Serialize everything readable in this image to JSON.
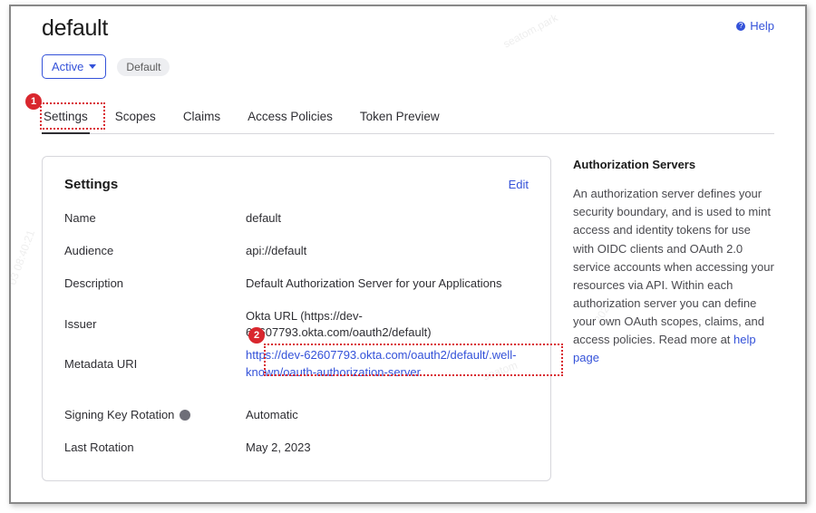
{
  "header": {
    "title": "default",
    "help_label": "Help"
  },
  "status": {
    "active_label": "Active",
    "pill_label": "Default"
  },
  "tabs": [
    {
      "label": "Settings"
    },
    {
      "label": "Scopes"
    },
    {
      "label": "Claims"
    },
    {
      "label": "Access Policies"
    },
    {
      "label": "Token Preview"
    }
  ],
  "panel": {
    "title": "Settings",
    "edit_label": "Edit",
    "rows": {
      "name_label": "Name",
      "name_value": "default",
      "audience_label": "Audience",
      "audience_value": "api://default",
      "description_label": "Description",
      "description_value": "Default Authorization Server for your Applications",
      "issuer_label": "Issuer",
      "issuer_value": "Okta URL (https://dev-62607793.okta.com/oauth2/default)",
      "metadata_label": "Metadata URI",
      "metadata_value": "https://dev-62607793.okta.com/oauth2/default/.well-known/oauth-authorization-server",
      "signing_label": "Signing Key Rotation",
      "signing_value": "Automatic",
      "lastrot_label": "Last Rotation",
      "lastrot_value": "May 2, 2023"
    }
  },
  "sidebar": {
    "heading": "Authorization Servers",
    "body": "An authorization server defines your security boundary, and is used to mint access and identity tokens for use with OIDC clients and OAuth 2.0 service accounts when accessing your resources via API. Within each authorization server you can define your own OAuth scopes, claims, and access policies. Read more at ",
    "link_text": "help page"
  },
  "callouts": {
    "one": "1",
    "two": "2"
  }
}
